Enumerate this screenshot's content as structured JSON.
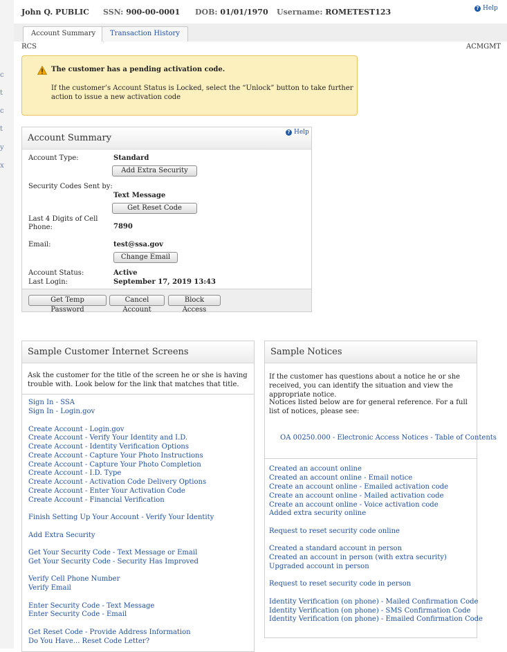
{
  "edge_chars": [
    "c",
    "t",
    "c",
    "t",
    "y",
    "x"
  ],
  "header": {
    "name": "John Q. PUBLIC",
    "ssn_label": "SSN:",
    "ssn_value": "900-00-0001",
    "dob_label": "DOB:",
    "dob_value": "01/01/1970",
    "username_label": "Username:",
    "username_value": "ROMETEST123",
    "help": "Help"
  },
  "tabs": [
    {
      "label": "Account Summary",
      "active": true
    },
    {
      "label": "Transaction History",
      "active": false
    }
  ],
  "left_code": "RCS",
  "right_code": "ACMGMT",
  "alert": {
    "title": "The customer has a pending activation code.",
    "body": "If the customer’s Account Status is Locked, select the “Unlock” button to take further action to issue a new activation code"
  },
  "account_summary": {
    "title": "Account Summary",
    "help": "Help",
    "account_type_label": "Account Type:",
    "account_type_value": "Standard",
    "add_extra_security_button": "Add Extra Security",
    "security_codes_label": "Security Codes Sent by:",
    "security_codes_value": "Text Message",
    "get_reset_code_button": "Get Reset Code",
    "cell_label_1": "Last 4 Digits of Cell",
    "cell_label_2": "Phone:",
    "cell_value": "7890",
    "email_label": "Email:",
    "email_value": "test@ssa.gov",
    "change_email_button": "Change Email",
    "status_label": "Account Status:",
    "status_value": "Active",
    "last_login_label": "Last Login:",
    "last_login_value": "September 17, 2019 13:43",
    "get_temp_password_button": "Get Temp Password",
    "cancel_account_button": "Cancel Account",
    "block_access_button": "Block Access"
  },
  "screens": {
    "title": "Sample Customer Internet Screens",
    "intro": "Ask the customer for the title of the screen he or she is having trouble with. Look below for the link that matches that title.",
    "links": [
      "Sign In - SSA",
      "Sign In - Login.gov",
      "Create Account - Login.gov",
      "Create Account - Verify Your Identity and I.D.",
      "Create Account - Identity Verification Options",
      "Create Account - Capture Your Photo Instructions",
      "Create Account - Capture Your Photo Completion",
      "Create Account - I.D. Type",
      "Create Account - Activation Code Delivery Options",
      "Create Account - Enter Your Activation Code",
      "Create Account - Financial Verification",
      "Finish Setting Up Your Account - Verify Your Identity",
      "Add Extra Security",
      "Get Your Security Code - Text Message or Email",
      "Get Your Security Code - Security Has Improved",
      "Verify Cell Phone Number",
      "Verify Email",
      "Enter Security Code - Text Message",
      "Enter Security Code - Email",
      "Get Reset Code - Provide Address Information",
      "Do You Have... Reset Code Letter?"
    ]
  },
  "notices": {
    "title": "Sample Notices",
    "intro1": "If the customer has questions about a notice he or she received, you can identify the situation and view the appropriate notice.",
    "intro2": "Notices listed below are for general reference. For a full list of notices, please see:",
    "toc_link": "OA 00250.000 - Electronic Access Notices - Table of Contents",
    "links": [
      "Created an account online",
      "Created an account online - Email notice",
      "Create an account online - Emailed activation code",
      "Create an account online - Mailed activation code",
      "Create an account online - Voice activation code",
      "Added extra security online",
      "Request to reset security code online",
      "Created a standard account in person",
      "Created an account in person (with extra security)",
      "Upgraded account in person",
      "Request to reset security code in person",
      "Identity Verification (on phone) - Mailed Confirmation Code",
      "Identity Verification (on phone) - SMS Confirmation Code",
      "Identity Verification (on phone) - Emailed Confirmation Code"
    ]
  }
}
